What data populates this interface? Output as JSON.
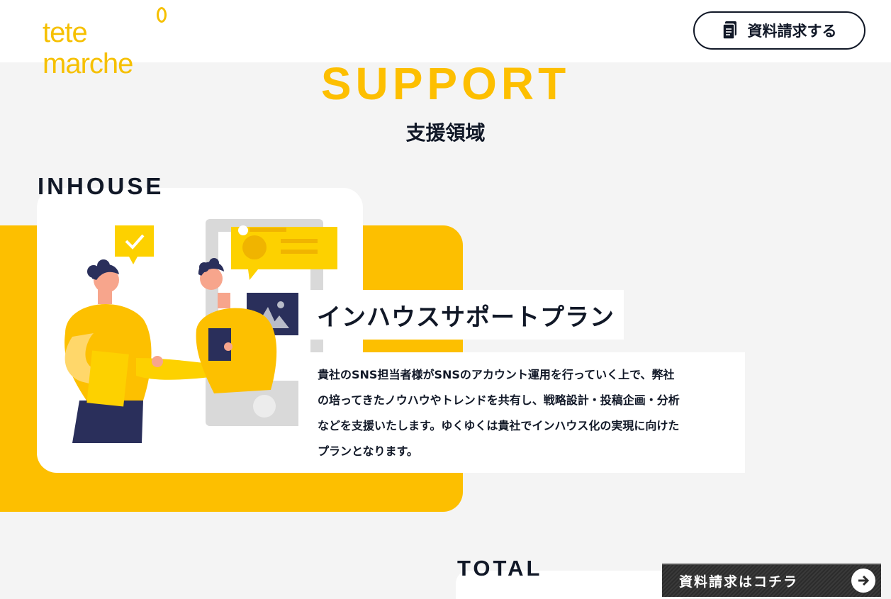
{
  "header": {
    "logo_text": "tete marche",
    "request_button_label": "資料請求する"
  },
  "section": {
    "title": "SUPPORT",
    "subtitle": "支援領域"
  },
  "inhouse": {
    "category_label": "INHOUSE",
    "plan_title": "インハウスサポートプラン",
    "description_lines": [
      "貴社のSNS担当者様がSNSのアカウント運用を行っていく上で、弊社",
      "の培ってきたノウハウやトレンドを共有し、戦略設計・投稿企画・分析",
      "などを支援いたします。ゆくゆくは貴社でインハウス化の実現に向けた",
      "プランとなります。"
    ]
  },
  "total": {
    "category_label": "TOTAL"
  },
  "floating_cta": {
    "label": "資料請求はコチラ"
  },
  "colors": {
    "brand_yellow": "#fdbf00",
    "text_dark": "#111827",
    "background": "#f4f4f4",
    "navy": "#2a2f5b"
  },
  "icons": [
    "document-icon",
    "arrow-right-circle-icon"
  ]
}
